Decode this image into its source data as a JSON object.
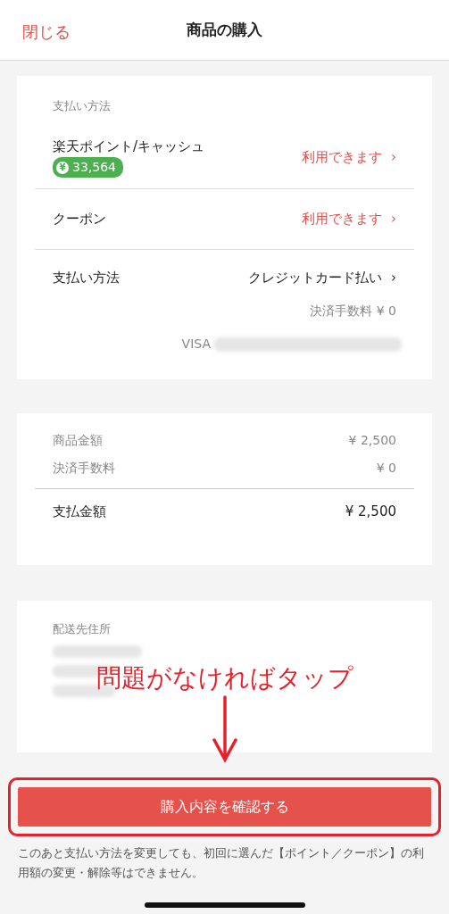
{
  "header": {
    "close": "閉じる",
    "title": "商品の購入"
  },
  "payment_card": {
    "heading": "支払い方法",
    "rows": [
      {
        "kind": "points",
        "label": "楽天ポイント/キャッシュ",
        "badge_icon": "¥",
        "badge": "33,564",
        "value": "利用できます",
        "chevron": "›"
      },
      {
        "kind": "link",
        "label": "クーポン",
        "value": "利用できます",
        "chevron": "›"
      },
      {
        "kind": "method",
        "label": "支払い方法",
        "value": "クレジットカード払い",
        "chevron": "›",
        "fee": "決済手数料 ¥ 0",
        "card_brand": "VISA"
      }
    ]
  },
  "total_card": {
    "rows": [
      {
        "kind": "minor",
        "label": "商品金額",
        "value": "¥ 2,500"
      },
      {
        "kind": "minor",
        "label": "決済手数料",
        "value": "¥ 0"
      },
      {
        "kind": "total",
        "label": "支払金額",
        "value": "¥ 2,500"
      }
    ]
  },
  "address_card": {
    "heading": "配送先住所"
  },
  "annotation": {
    "text": "問題がなければタップ"
  },
  "confirm_button": "購入内容を確認する",
  "notice": "このあと支払い方法を変更しても、初回に選んだ【ポイント／クーポン】の利用額の変更・解除等はできません。"
}
